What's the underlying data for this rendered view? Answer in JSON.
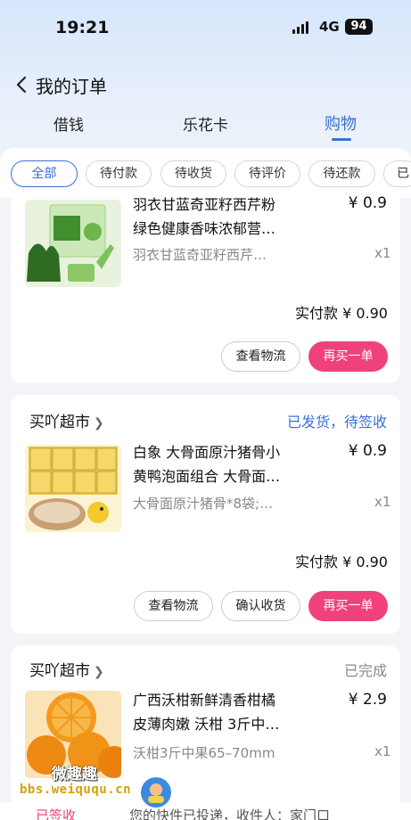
{
  "status_bar": {
    "time": "19:21",
    "network": "4G",
    "battery": "94"
  },
  "header": {
    "title": "我的订单"
  },
  "main_tabs": [
    {
      "label": "借钱"
    },
    {
      "label": "乐花卡"
    },
    {
      "label": "购物",
      "active": true
    }
  ],
  "filters": [
    {
      "label": "全部",
      "active": true
    },
    {
      "label": "待付款"
    },
    {
      "label": "待收货"
    },
    {
      "label": "待评价"
    },
    {
      "label": "待还款"
    },
    {
      "label": "已"
    }
  ],
  "orders": [
    {
      "name": "羽衣甘蓝奇亚籽西芹粉绿色健康香味浓郁营…",
      "name_line1": "羽衣甘蓝奇亚籽西芹粉",
      "name_line2": "绿色健康香味浓郁营…",
      "spec": "羽衣甘蓝奇亚籽西芹…",
      "price": "¥ 0.9",
      "qty": "x1",
      "paid": "实付款 ¥ 0.90",
      "buttons": [
        "查看物流",
        "再买一单"
      ],
      "thumb_text": "羽衣甘蓝奇亚籽西芹粉"
    },
    {
      "store": "买吖超市",
      "status": "已发货，待签收",
      "name_line1": "白象 大骨面原汁猪骨小",
      "name_line2": "黄鸭泡面组合 大骨面…",
      "spec": "大骨面原汁猪骨*8袋;…",
      "price": "¥ 0.9",
      "qty": "x1",
      "paid": "实付款 ¥ 0.90",
      "buttons": [
        "查看物流",
        "确认收货",
        "再买一单"
      ]
    },
    {
      "store": "买吖超市",
      "status": "已完成",
      "name_line1": "广西沃柑新鲜清香柑橘",
      "name_line2": "皮薄肉嫩 沃柑 3斤中…",
      "spec": "沃柑3斤中果65–70mm",
      "price": "¥ 2.9",
      "qty": "x1"
    }
  ],
  "bottom": {
    "signed": "已签收",
    "message": "您的快件已投递，收件人：家门口"
  },
  "watermark": {
    "text": "微趣趣",
    "url": "bbs.weiququ.cn"
  },
  "colors": {
    "accent": "#3b6fd6",
    "primary_button": "#f0427a",
    "status_shipping": "#3b6fd6",
    "status_done": "#888888"
  }
}
